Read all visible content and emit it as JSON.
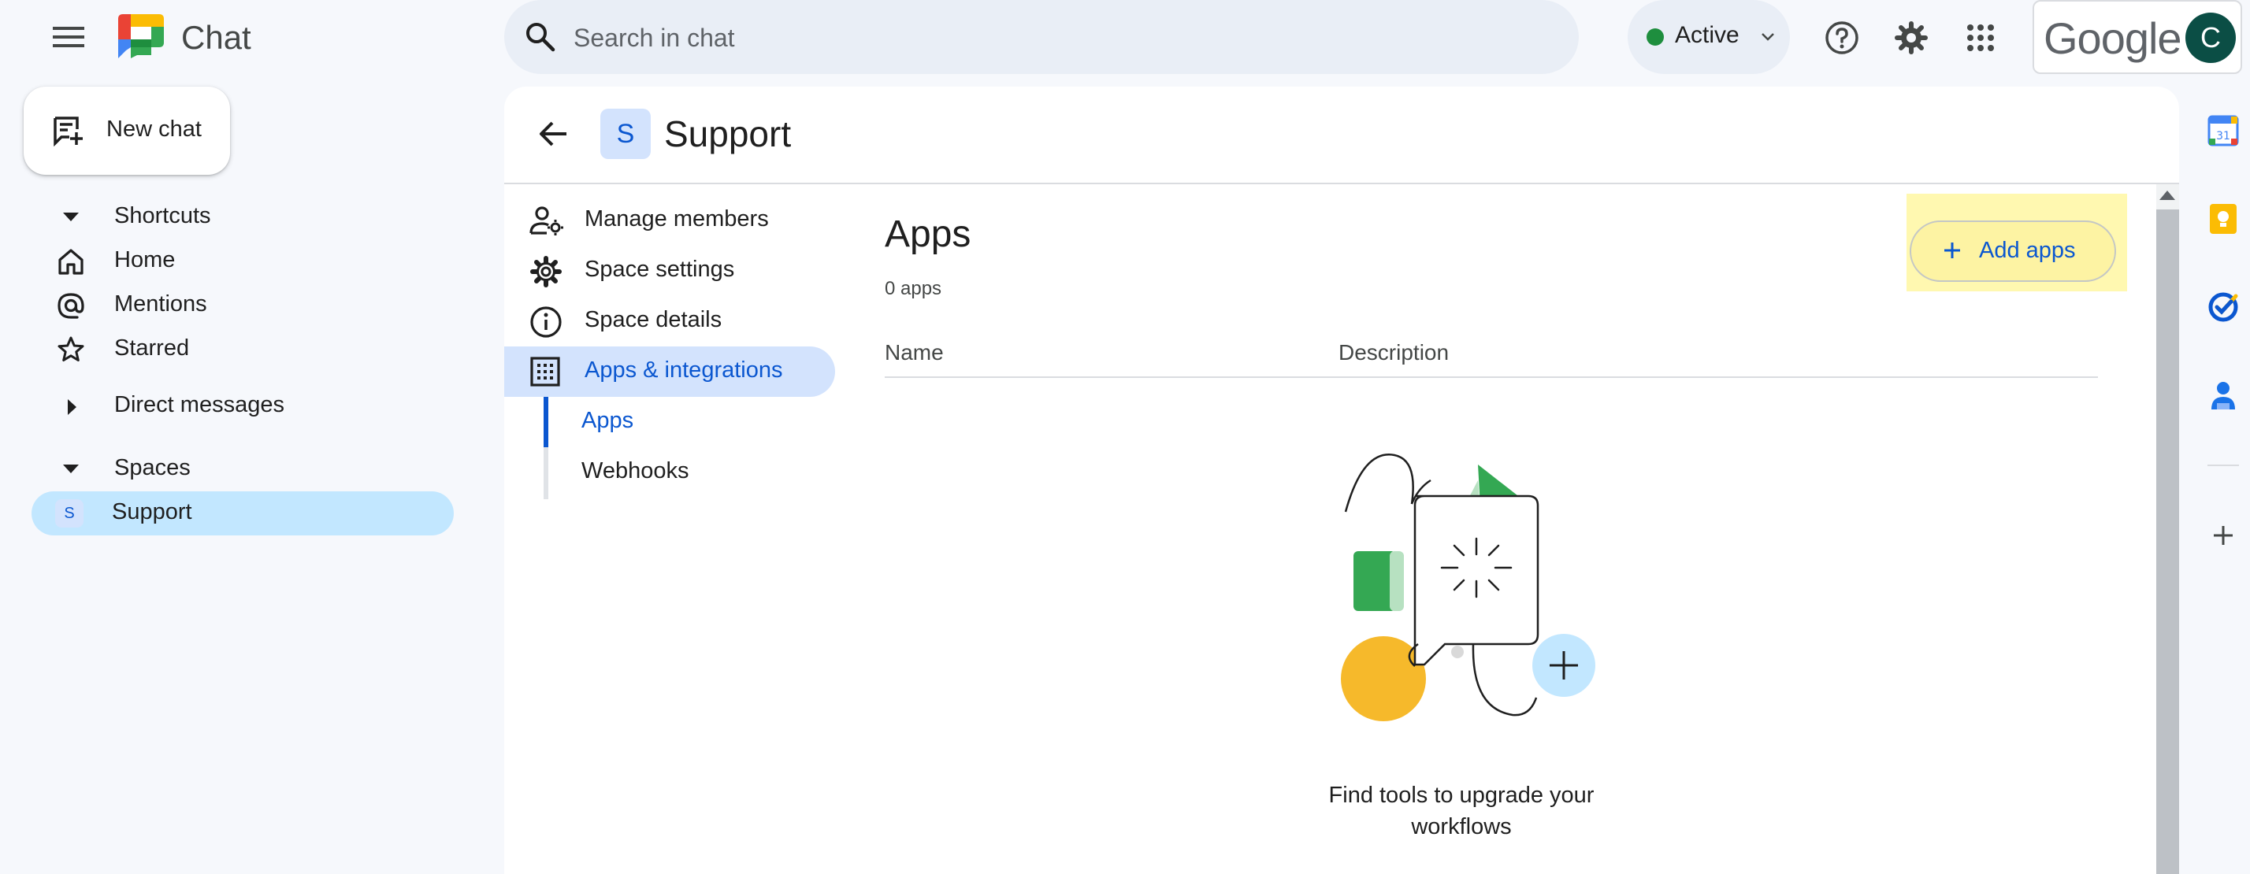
{
  "app": {
    "title": "Chat"
  },
  "search": {
    "placeholder": "Search in chat"
  },
  "status": {
    "label": "Active",
    "color": "#1e8e3e"
  },
  "account": {
    "brand": "Google",
    "avatar_letter": "C",
    "avatar_color": "#0b4e45"
  },
  "sidebar": {
    "new_chat_label": "New chat",
    "shortcuts": {
      "label": "Shortcuts",
      "items": [
        {
          "label": "Home",
          "icon": "home-icon"
        },
        {
          "label": "Mentions",
          "icon": "at-sign-icon"
        },
        {
          "label": "Starred",
          "icon": "star-icon"
        }
      ]
    },
    "direct_messages": {
      "label": "Direct messages"
    },
    "spaces": {
      "label": "Spaces",
      "items": [
        {
          "label": "Support",
          "avatar_letter": "S",
          "selected": true
        }
      ]
    }
  },
  "space": {
    "avatar_letter": "S",
    "title": "Support",
    "menu": [
      {
        "label": "Manage members",
        "icon": "manage-members-icon"
      },
      {
        "label": "Space settings",
        "icon": "gear-icon"
      },
      {
        "label": "Space details",
        "icon": "info-icon"
      },
      {
        "label": "Apps & integrations",
        "icon": "apps-grid-icon",
        "selected": true
      }
    ],
    "submenu": [
      {
        "label": "Apps",
        "selected": true
      },
      {
        "label": "Webhooks"
      }
    ]
  },
  "apps_page": {
    "title": "Apps",
    "count_label": "0 apps",
    "add_button_label": "Add apps",
    "columns": [
      "Name",
      "Description"
    ],
    "empty_message": "Find tools to upgrade your workflows"
  },
  "colors": {
    "accent": "#0b57d0",
    "selected_bg": "#c2e7ff",
    "highlight": "#fff8b0",
    "illustration_green": "#34a853",
    "illustration_yellow": "#f6b92b",
    "illustration_blue": "#c2e7ff"
  },
  "right_rail": {
    "icons": [
      "calendar-icon",
      "keep-icon",
      "tasks-icon",
      "contacts-icon",
      "add-icon"
    ],
    "calendar_day": "31"
  }
}
